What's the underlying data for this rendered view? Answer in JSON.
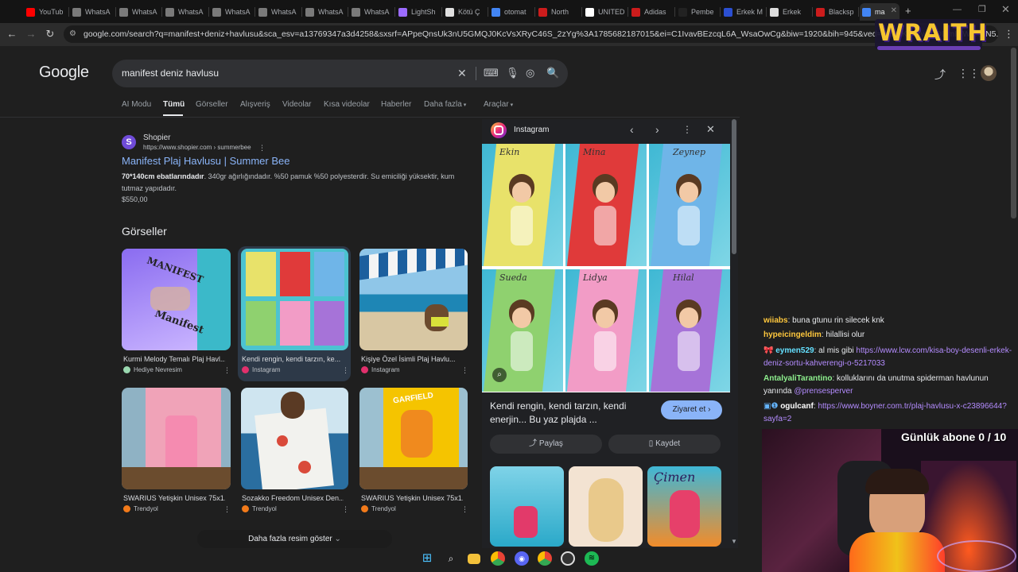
{
  "browser": {
    "tabs": [
      {
        "label": "YouTub",
        "color": "#ff0000"
      },
      {
        "label": "WhatsA",
        "color": "#7a7a7a"
      },
      {
        "label": "WhatsA",
        "color": "#7a7a7a"
      },
      {
        "label": "WhatsA",
        "color": "#7a7a7a"
      },
      {
        "label": "WhatsA",
        "color": "#7a7a7a"
      },
      {
        "label": "WhatsA",
        "color": "#7a7a7a"
      },
      {
        "label": "WhatsA",
        "color": "#7a7a7a"
      },
      {
        "label": "WhatsA",
        "color": "#7a7a7a"
      },
      {
        "label": "LightSh",
        "color": "#9b6bff"
      },
      {
        "label": "Kötü Ç",
        "color": "#e0e0e0"
      },
      {
        "label": "otomat",
        "color": "#4285f4"
      },
      {
        "label": "North",
        "color": "#cc1c1c"
      },
      {
        "label": "UNITED",
        "color": "#ffffff"
      },
      {
        "label": "Adidas",
        "color": "#cc1c1c"
      },
      {
        "label": "Pembe",
        "color": "#222222"
      },
      {
        "label": "Erkek M",
        "color": "#2b4fd1"
      },
      {
        "label": "Erkek",
        "color": "#dddddd"
      },
      {
        "label": "Blacksp",
        "color": "#cc1c1c"
      },
      {
        "label": "ma",
        "color": "#4285f4"
      }
    ],
    "new_tab": "+",
    "url": "google.com/search?q=manifest+deniz+havlusu&sca_esv=a13769347a3d4258&sxsrf=APpeQnsUk3nU5GMQJ0KcVsXRyC46S_2zYg%3A1785682187015&ei=C1IvavBEzcqL6A_WsaOwCg&biw=1920&bih=945&ved=0ahUKEwiw9sDDmIKWAxVN5..."
  },
  "overlay": {
    "brand": "WRAITH",
    "sub_goal": "Günlük abone 0 / 10"
  },
  "google": {
    "logo": "Google",
    "query": "manifest deniz havlusu",
    "tabs": [
      "AI Modu",
      "Tümü",
      "Görseller",
      "Alışveriş",
      "Videolar",
      "Kısa videolar",
      "Haberler",
      "Daha fazla",
      "Araçlar"
    ],
    "result": {
      "favicon_letter": "S",
      "site": "Shopier",
      "url": "https://www.shopier.com › summerbee",
      "title": "Manifest Plaj Havlusu | Summer Bee",
      "snippet_bold": "70*140cm ebatlarındadır",
      "snippet": ". 340gr ağırlığındadır. %50 pamuk %50 polyesterdir. Su emiciliği yüksektir, kum tutmaz yapıdadır.",
      "price": "$550,00"
    },
    "images_heading": "Görseller",
    "images": [
      {
        "caption": "Kurmi Melody Temalı Plaj Havl...",
        "source": "Hediye Nevresim",
        "src_color": "#9ad8b0"
      },
      {
        "caption": "Kendi rengin, kendi tarzın, ke...",
        "source": "Instagram",
        "src_color": "#e1306c"
      },
      {
        "caption": "Kişiye Özel İsimli Plaj Havlu...",
        "source": "Instagram",
        "src_color": "#e1306c"
      },
      {
        "caption": "SWARIUS Yetişkin Unisex 75x1...",
        "source": "Trendyol",
        "src_color": "#f27a1a"
      },
      {
        "caption": "Sozakko Freedom Unisex Den...",
        "source": "Trendyol",
        "src_color": "#f27a1a"
      },
      {
        "caption": "SWARIUS Yetişkin Unisex 75x1...",
        "source": "Trendyol",
        "src_color": "#f27a1a"
      }
    ],
    "more_images": "Daha fazla resim göster",
    "thumb_texts": {
      "manifest_top": "MANIFEST",
      "manifest_bottom": "Manifest",
      "garfield": "GARFIELD"
    }
  },
  "panel": {
    "source": "Instagram",
    "names": [
      "Ekin",
      "Mina",
      "Zeynep",
      "Sueda",
      "Lidya",
      "Hilal"
    ],
    "towel_colors": [
      "#e8e26a",
      "#e03a3a",
      "#6fb5e8",
      "#8fd16f",
      "#f29cc6",
      "#a673d8"
    ],
    "title": "Kendi rengin, kendi tarzın, kendi enerjin... Bu yaz plajda ...",
    "visit": "Ziyaret et",
    "share": "Paylaş",
    "save": "Kaydet",
    "related_name": "Çimen"
  },
  "chat": [
    {
      "user": "wiiabs",
      "text": ": buna gtunu rin silecek knk",
      "ucls": "u1"
    },
    {
      "user": "hypeicingeldim",
      "text": ": hilallisi olur",
      "ucls": "u1"
    },
    {
      "user": "eymen529",
      "text": ": al mis gibi ",
      "link": "https://www.lcw.com/kisa-boy-desenli-erkek-deniz-sortu-kahverengi-o-5217033",
      "ucls": "u3",
      "badge": "🎀"
    },
    {
      "user": "AntalyaliTarantino",
      "text": ": kolluklarını da unutma spiderman havlunun yanında ",
      "mention": "@prensesperver",
      "ucls": "u4"
    },
    {
      "user": "ogulcanf",
      "text": ": ",
      "link": "https://www.boyner.com.tr/plaj-havlusu-x-c23896644?sayfa=2",
      "ucls": "u2",
      "badge": "▣❶"
    }
  ],
  "taskbar": [
    "windows-start",
    "search",
    "file-explorer",
    "chrome",
    "discord",
    "chrome-profile",
    "obs",
    "spotify"
  ],
  "colors": {
    "bg": "#1f1f1f",
    "link": "#8ab4f8",
    "panel": "#202124",
    "accent_purple": "#b48cff"
  }
}
